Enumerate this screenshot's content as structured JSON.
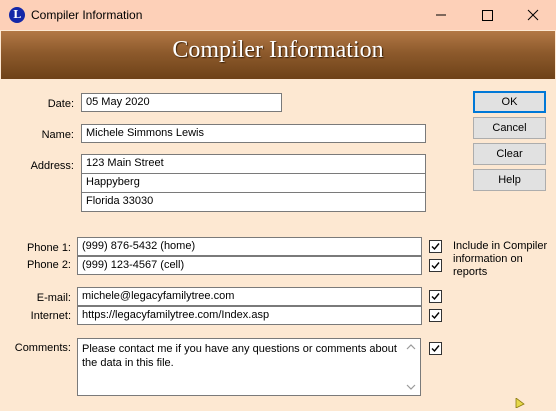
{
  "window": {
    "title": "Compiler Information",
    "app_icon_letter": "L",
    "banner_title": "Compiler Information"
  },
  "form": {
    "date_label": "Date:",
    "date_value": "05 May 2020",
    "name_label": "Name:",
    "name_value": "Michele Simmons Lewis",
    "address_label": "Address:",
    "address_lines": [
      "123 Main Street",
      "Happyberg",
      "Florida 33030"
    ],
    "phone1_label": "Phone 1:",
    "phone1_value": "(999) 876-5432 (home)",
    "phone2_label": "Phone 2:",
    "phone2_value": "(999) 123-4567 (cell)",
    "email_label": "E-mail:",
    "email_value": "michele@legacyfamilytree.com",
    "internet_label": "Internet:",
    "internet_value": "https://legacyfamilytree.com/Index.asp",
    "comments_label": "Comments:",
    "comments_value": "Please contact me if you have any questions or comments about the data in this file.",
    "include_note": "Include in Compiler information on reports"
  },
  "checkboxes": {
    "phone1": true,
    "phone2": true,
    "email": true,
    "internet": true,
    "comments": true
  },
  "buttons": {
    "ok_label": "OK",
    "cancel_label": "Cancel",
    "clear_label": "Clear",
    "help_label": "Help"
  },
  "colors": {
    "background": "#fde8d2",
    "titlebar": "#fdd0b8",
    "banner": "#8d5a2c",
    "default_button_border": "#0078d7"
  }
}
